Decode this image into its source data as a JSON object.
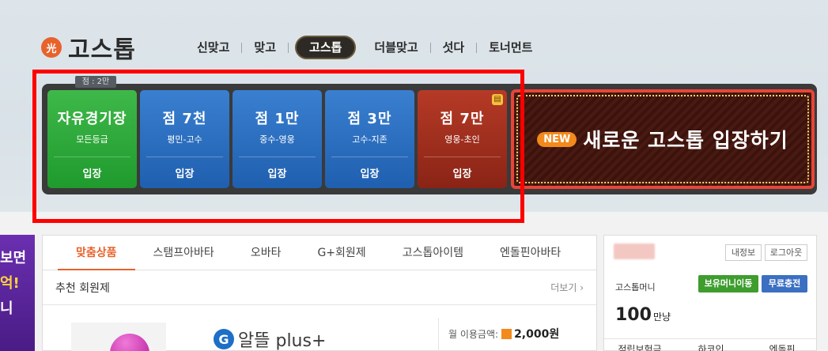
{
  "logo": {
    "mark": "光",
    "text": "고스톱"
  },
  "nav": [
    "신맞고",
    "맞고",
    "고스톱",
    "더블맞고",
    "섯다",
    "토너먼트"
  ],
  "room_badge": "점 : 2만",
  "rooms": [
    {
      "title": "자유경기장",
      "sub": "모든등급",
      "enter": "입장",
      "color": "green"
    },
    {
      "title": "점 7천",
      "sub": "평민-고수",
      "enter": "입장",
      "color": "blue"
    },
    {
      "title": "점 1만",
      "sub": "중수-영웅",
      "enter": "입장",
      "color": "blue"
    },
    {
      "title": "점 3만",
      "sub": "고수-지존",
      "enter": "입장",
      "color": "blue"
    },
    {
      "title": "점 7만",
      "sub": "영웅-초인",
      "enter": "입장",
      "color": "red"
    }
  ],
  "new_entry": {
    "badge": "NEW",
    "text": "새로운 고스톱 입장하기"
  },
  "left_banner": [
    "보면",
    "억!",
    "니"
  ],
  "tabs": [
    "맞춤상품",
    "스탬프아바타",
    "오바타",
    "G+회원제",
    "고스톱아이템",
    "엔돌핀아바타"
  ],
  "section": {
    "title": "추천 회원제",
    "more": "더보기 ›"
  },
  "product": {
    "logo": "G",
    "name": "알뜰 plus+",
    "price_label": "월 이용금액:",
    "price": "2,000원"
  },
  "user": {
    "my_info": "내정보",
    "logout": "로그아웃",
    "money_label": "고스톱머니",
    "transfer": "보유머니이동",
    "free_charge": "무료충전",
    "money": "100",
    "money_unit": "만냥",
    "footer": [
      "적립보험금",
      "하코인",
      "엔돌핀"
    ]
  },
  "colors": {
    "accent": "#e8622c",
    "highlight": "#ff0000",
    "green": "#1f9a2c",
    "blue": "#1f5faf",
    "red": "#8a2416"
  }
}
